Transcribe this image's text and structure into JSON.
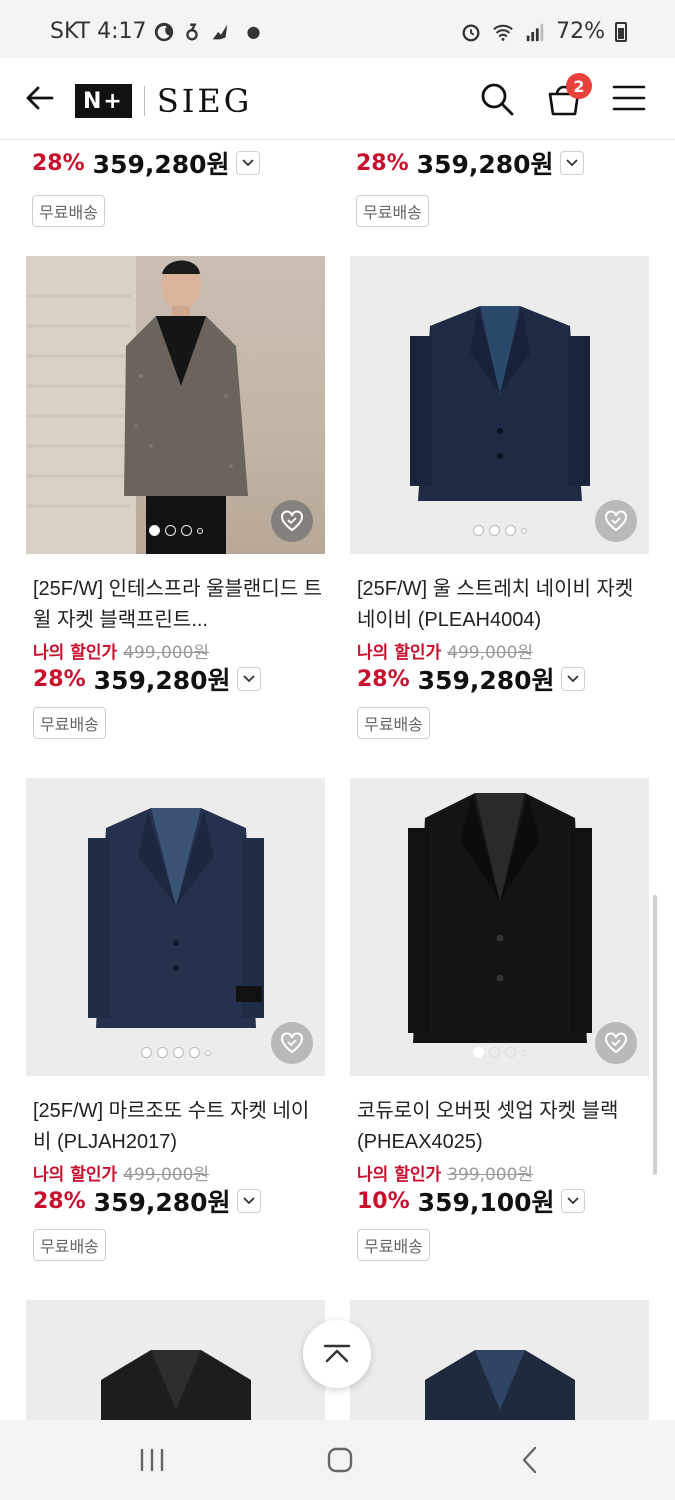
{
  "status_bar": {
    "carrier_time": "SKT 4:17",
    "battery": "72%"
  },
  "header": {
    "logo_prefix": "N+",
    "brand": "SIEG",
    "cart_count": "2"
  },
  "top_partial": {
    "left": {
      "discount": "28%",
      "price": "359,280원",
      "shipping": "무료배송"
    },
    "right": {
      "discount": "28%",
      "price": "359,280원",
      "shipping": "무료배송"
    }
  },
  "products": [
    {
      "title": "[25F/W] 인테스프라 울블랜디드 트윌 자켓 블랙프린트...",
      "sale_label": "나의 할인가",
      "original_price": "499,000원",
      "discount": "28%",
      "price": "359,280원",
      "shipping": "무료배송"
    },
    {
      "title": "[25F/W] 울 스트레치 네이비 자켓 네이비 (PLEAH4004)",
      "sale_label": "나의 할인가",
      "original_price": "499,000원",
      "discount": "28%",
      "price": "359,280원",
      "shipping": "무료배송"
    },
    {
      "title": "[25F/W] 마르조또 수트 자켓 네이비 (PLJAH2017)",
      "sale_label": "나의 할인가",
      "original_price": "499,000원",
      "discount": "28%",
      "price": "359,280원",
      "shipping": "무료배송"
    },
    {
      "title": "코듀로이 오버핏 셋업 자켓 블랙 (PHEAX4025)",
      "sale_label": "나의 할인가",
      "original_price": "399,000원",
      "discount": "10%",
      "price": "359,100원",
      "shipping": "무료배송"
    }
  ],
  "colors": {
    "accent_red": "#c8102e",
    "badge_red": "#e9413b"
  }
}
